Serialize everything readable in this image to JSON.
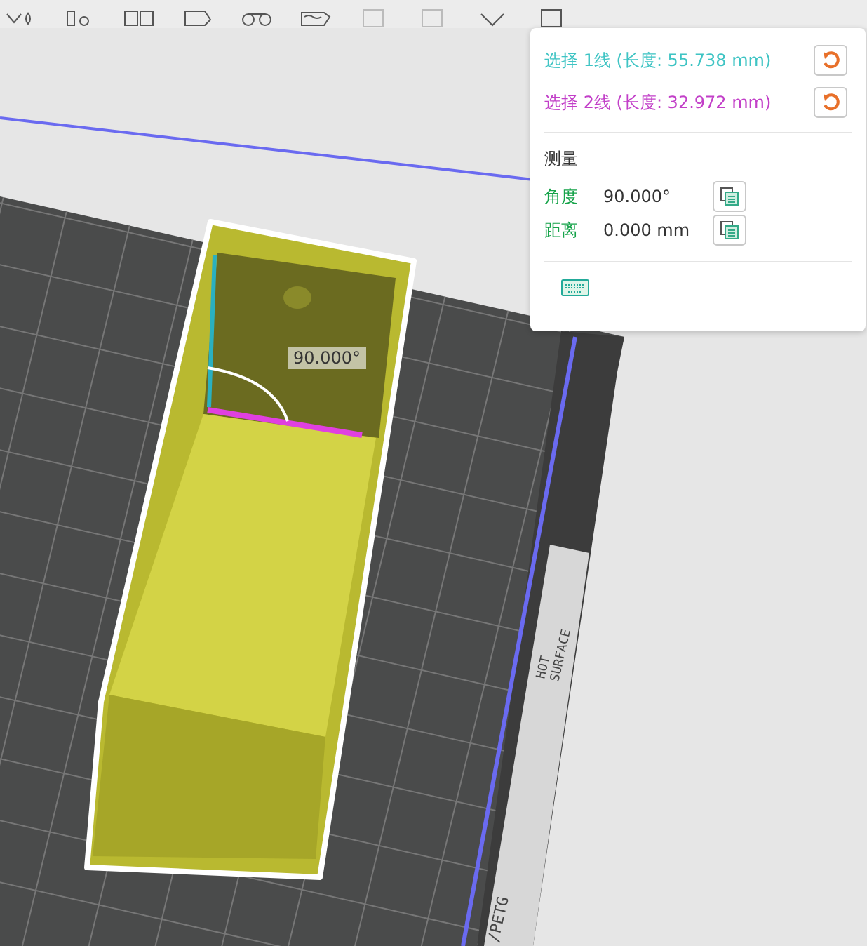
{
  "measure_panel": {
    "selections": [
      {
        "label": "选择 1线 (长度: 55.738 mm)",
        "color": "#3fc4c4"
      },
      {
        "label": "选择 2线 (长度: 32.972 mm)",
        "color": "#c23fc8"
      }
    ],
    "section_title": "测量",
    "results": [
      {
        "label": "角度",
        "value": "90.000°"
      },
      {
        "label": "距离",
        "value": "0.000 mm"
      }
    ]
  },
  "viewport": {
    "angle_label": "90.000°",
    "bed_labels": [
      "HOT",
      "SURFACE",
      "/PETG"
    ]
  }
}
